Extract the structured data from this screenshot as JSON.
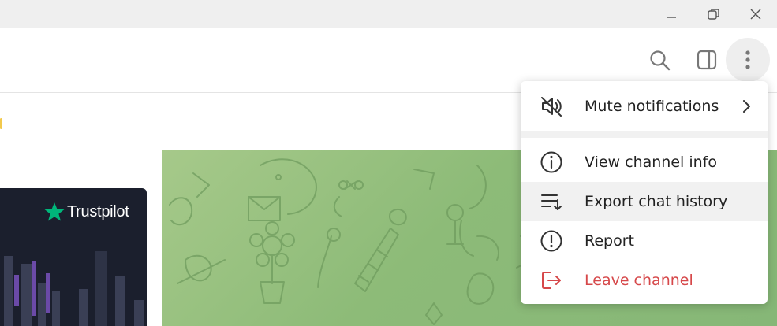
{
  "window_controls": {
    "minimize_icon": "minimize-icon",
    "restore_icon": "restore-icon",
    "close_icon": "close-icon"
  },
  "header_actions": {
    "search_icon": "search-icon",
    "sidebar_icon": "sidebar-toggle-icon",
    "more_icon": "more-vertical-icon"
  },
  "ad_card": {
    "brand": "Trustpilot",
    "star_color": "#00b67a"
  },
  "menu": {
    "items": [
      {
        "label": "Mute notifications",
        "icon": "mute-icon",
        "has_submenu": true
      },
      {
        "label": "View channel info",
        "icon": "info-icon"
      },
      {
        "label": "Export chat history",
        "icon": "export-icon",
        "highlighted": true
      },
      {
        "label": "Report",
        "icon": "report-icon"
      },
      {
        "label": "Leave channel",
        "icon": "leave-icon",
        "danger": true
      }
    ]
  },
  "colors": {
    "danger": "#d6484a",
    "chat_background": "#8dbb78",
    "titlebar": "#efefef"
  }
}
